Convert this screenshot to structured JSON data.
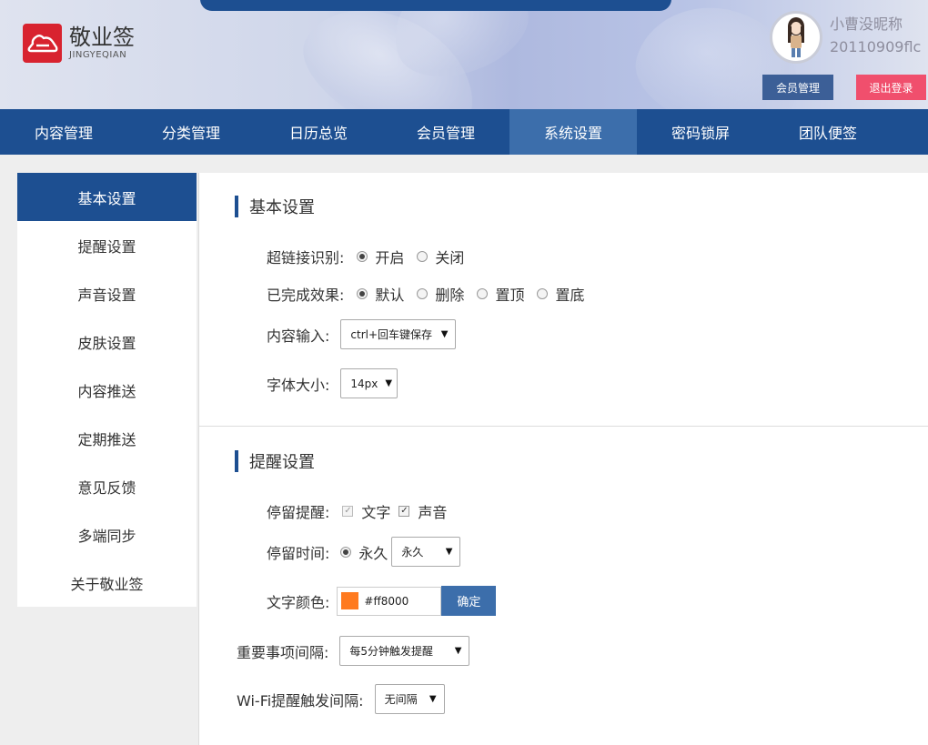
{
  "header": {
    "logo_cn": "敬业签",
    "logo_en": "JINGYEQIAN",
    "nickname": "小曹没昵称",
    "username": "20110909flc",
    "member_btn": "会员管理",
    "logout_btn": "退出登录",
    "brand_color": "#d8232f"
  },
  "nav": {
    "items": [
      "内容管理",
      "分类管理",
      "日历总览",
      "会员管理",
      "系统设置",
      "密码锁屏",
      "团队便签"
    ],
    "active": "系统设置"
  },
  "sidebar": {
    "items": [
      "基本设置",
      "提醒设置",
      "声音设置",
      "皮肤设置",
      "内容推送",
      "定期推送",
      "意见反馈",
      "多端同步",
      "关于敬业签"
    ],
    "active": "基本设置"
  },
  "basic": {
    "title": "基本设置",
    "hyperlink_label": "超链接识别:",
    "hyperlink_on": "开启",
    "hyperlink_off": "关闭",
    "hyperlink_value": "开启",
    "done_label": "已完成效果:",
    "done_options": [
      "默认",
      "删除",
      "置顶",
      "置底"
    ],
    "done_value": "默认",
    "input_label": "内容输入:",
    "input_value": "ctrl+回车键保存",
    "font_label": "字体大小:",
    "font_value": "14px"
  },
  "reminder": {
    "title": "提醒设置",
    "stay_label": "停留提醒:",
    "stay_text": "文字",
    "stay_sound": "声音",
    "stay_text_checked": true,
    "stay_sound_checked": true,
    "time_label": "停留时间:",
    "time_radio": "永久",
    "time_select": "永久",
    "color_label": "文字颜色:",
    "color_value": "#ff8000",
    "color_swatch": "#ff7a1f",
    "confirm_btn": "确定",
    "important_label": "重要事项间隔:",
    "important_value": "每5分钟触发提醒",
    "wifi_label": "Wi-Fi提醒触发间隔:",
    "wifi_value": "无间隔"
  },
  "colors": {
    "primary": "#1d4f91",
    "nav_active": "#3c6eab",
    "logout": "#f04f6d"
  }
}
